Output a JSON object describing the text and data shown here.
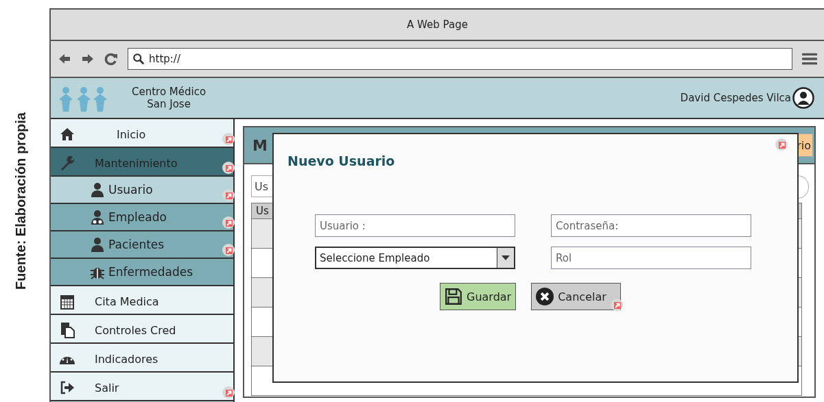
{
  "caption": "Fuente: Elaboración propia",
  "window": {
    "title": "A Web Page"
  },
  "toolbar": {
    "url": "http://"
  },
  "header": {
    "brand_lines": [
      "Centro Médico",
      "San Jose"
    ],
    "user": "David Cespedes Vilca"
  },
  "sidebar": {
    "items": [
      {
        "label": "Inicio",
        "kind": "main",
        "selected": false,
        "link": true
      },
      {
        "label": "Mantenimiento",
        "kind": "main",
        "selected": true,
        "link": true
      },
      {
        "label": "Usuario",
        "kind": "sub",
        "selected": true,
        "link": true
      },
      {
        "label": "Empleado",
        "kind": "sub",
        "selected": false,
        "link": true
      },
      {
        "label": "Pacientes",
        "kind": "sub",
        "selected": false,
        "link": true
      },
      {
        "label": "Enfermedades",
        "kind": "sub",
        "selected": false,
        "link": false
      },
      {
        "label": "Cita Medica",
        "kind": "main",
        "selected": false,
        "link": false
      },
      {
        "label": "Controles Cred",
        "kind": "main",
        "selected": false,
        "link": false
      },
      {
        "label": "Indicadores",
        "kind": "main",
        "selected": false,
        "link": false
      },
      {
        "label": "Salir",
        "kind": "main",
        "selected": false,
        "link": true
      }
    ]
  },
  "page": {
    "title": "M",
    "add_button": "rio",
    "filter": {
      "value": "Us"
    },
    "table": {
      "columns": [
        "Us"
      ],
      "rows": [
        {
          "shaded": true
        },
        {
          "shaded": false
        },
        {
          "shaded": true
        },
        {
          "shaded": false
        },
        {
          "shaded": true
        },
        {
          "shaded": false
        }
      ]
    }
  },
  "dialog": {
    "title": "Nuevo Usuario",
    "close_link": true,
    "fields": [
      {
        "kind": "text",
        "placeholder": "Usuario :"
      },
      {
        "kind": "text",
        "placeholder": "Contraseña:"
      },
      {
        "kind": "select",
        "value": "Seleccione Empleado"
      },
      {
        "kind": "text",
        "placeholder": "Rol"
      }
    ],
    "buttons": [
      {
        "label": "Guardar",
        "kind": "primary",
        "link": false
      },
      {
        "label": "Cancelar",
        "kind": "secondary",
        "link": true
      }
    ]
  }
}
